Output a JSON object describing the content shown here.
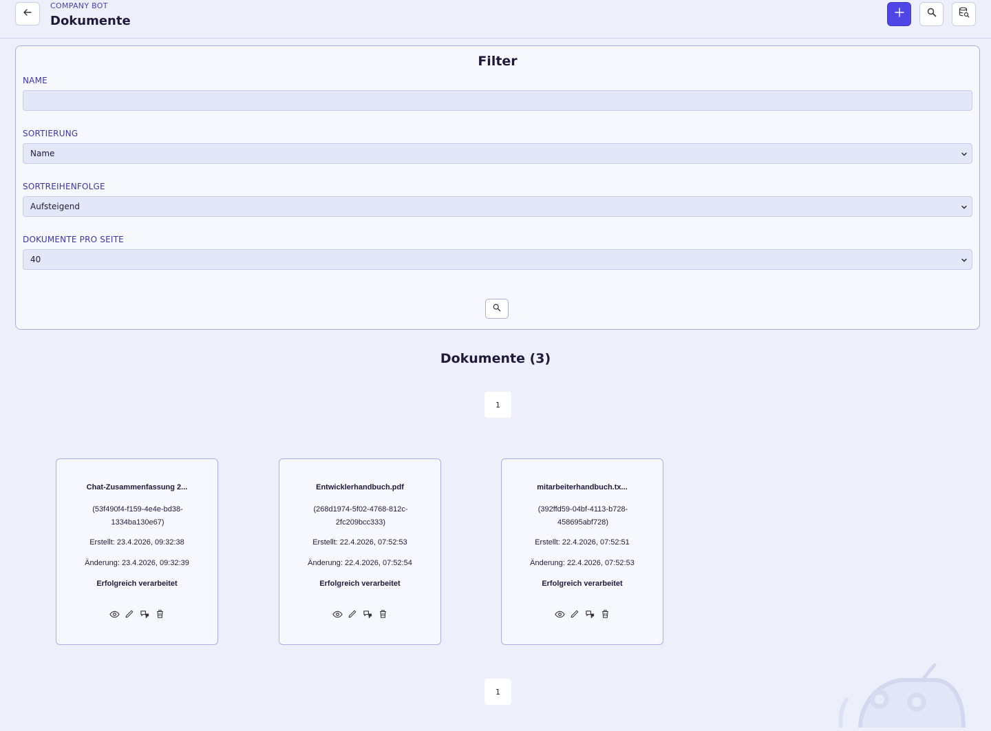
{
  "header": {
    "eyebrow": "COMPANY BOT",
    "title": "Dokumente"
  },
  "filter": {
    "title": "Filter",
    "name": {
      "label": "NAME",
      "value": "",
      "placeholder": ""
    },
    "sort": {
      "label": "SORTIERUNG",
      "value": "Name"
    },
    "order": {
      "label": "SORTREIHENFOLGE",
      "value": "Aufsteigend"
    },
    "per_page": {
      "label": "DOKUMENTE PRO SEITE",
      "value": "40"
    }
  },
  "list": {
    "heading": "Dokumente (3)",
    "page_top": "1",
    "page_bottom": "1"
  },
  "documents": [
    {
      "name": "Chat-Zusammenfassung 2...",
      "id": "(53f490f4-f159-4e4e-bd38-1334ba130e67)",
      "created": "Erstellt: 23.4.2026, 09:32:38",
      "changed": "Änderung: 23.4.2026, 09:32:39",
      "status": "Erfolgreich verarbeitet"
    },
    {
      "name": "Entwicklerhandbuch.pdf",
      "id": "(268d1974-5f02-4768-812c-2fc209bcc333)",
      "created": "Erstellt: 22.4.2026, 07:52:53",
      "changed": "Änderung: 22.4.2026, 07:52:54",
      "status": "Erfolgreich verarbeitet"
    },
    {
      "name": "mitarbeiterhandbuch.tx...",
      "id": "(392ffd59-04bf-4113-b728-458695abf728)",
      "created": "Erstellt: 22.4.2026, 07:52:51",
      "changed": "Änderung: 22.4.2026, 07:52:53",
      "status": "Erfolgreich verarbeitet"
    }
  ],
  "colors": {
    "background": "#edf0fb",
    "accent": "#5046e5",
    "label": "#3b36a8",
    "card_border": "#a9b0e8"
  },
  "icons": [
    "arrow-left-icon",
    "plus-icon",
    "search-icon",
    "database-search-icon",
    "chevron-down-icon",
    "eye-icon",
    "pencil-icon",
    "chat-icon",
    "trash-icon"
  ]
}
